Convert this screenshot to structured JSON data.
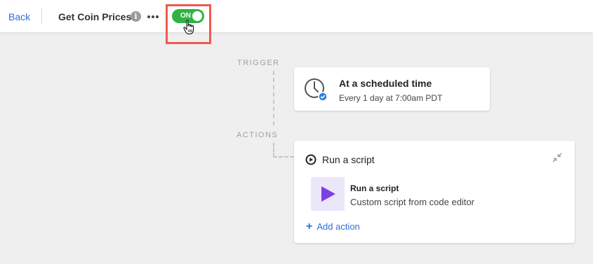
{
  "topbar": {
    "back_label": "Back",
    "title": "Get Coin Prices",
    "info_icon": "info-icon",
    "more_icon": "more-options-icon",
    "toggle": {
      "label": "ON",
      "state": "on",
      "color": "#2fb344"
    },
    "highlight_color": "#ee5a4f"
  },
  "flow": {
    "trigger_label": "TRIGGER",
    "actions_label": "ACTIONS",
    "trigger": {
      "icon": "clock-icon",
      "title": "At a scheduled time",
      "subtitle": "Every 1 day at 7:00am PDT"
    },
    "action": {
      "icon": "run-script-icon",
      "title": "Run a script",
      "step": {
        "icon": "play-icon",
        "title": "Run a script",
        "subtitle": "Custom script from code editor"
      },
      "add_action_label": "Add action"
    }
  },
  "colors": {
    "link": "#2f6fd6",
    "play_purple": "#7b3fe4",
    "check_blue": "#2f7fe0"
  }
}
